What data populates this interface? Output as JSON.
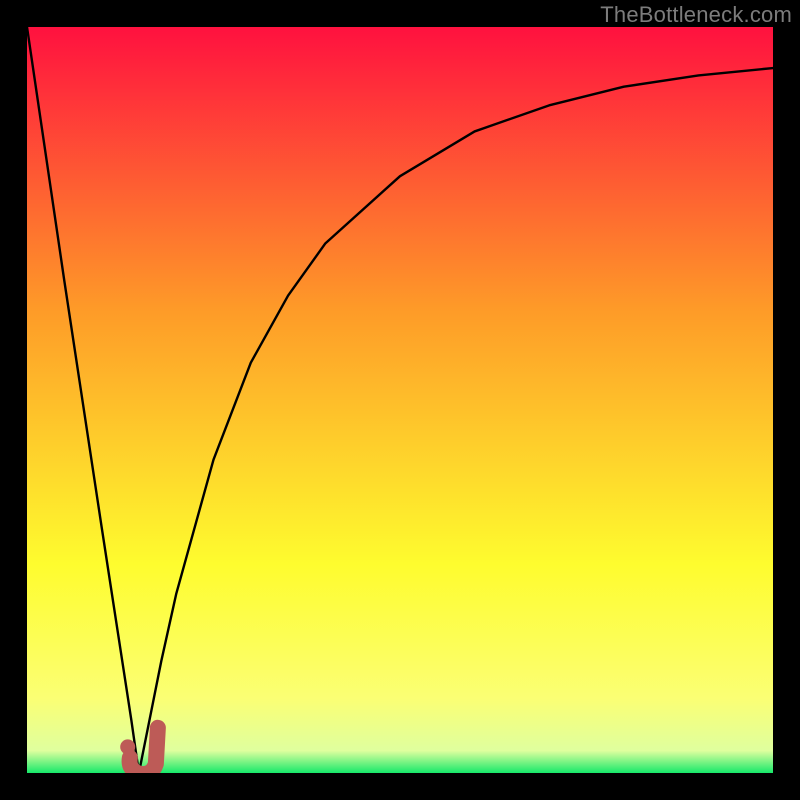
{
  "watermark": "TheBottleneck.com",
  "colors": {
    "frame": "#000000",
    "curve": "#000000",
    "marker_fill": "#bd5b57",
    "marker_stroke": "#bd5b57",
    "grad_top": "#ff113f",
    "grad_mid1": "#fe9b28",
    "grad_mid2": "#fefc2e",
    "grad_band": "#fbff74",
    "grad_bot": "#17e96a"
  },
  "chart_data": {
    "type": "line",
    "title": "",
    "xlabel": "",
    "ylabel": "",
    "xlim": [
      0,
      10
    ],
    "ylim": [
      0,
      100
    ],
    "grid": false,
    "series": [
      {
        "name": "bottleneck-curve",
        "x": [
          0.0,
          0.5,
          1.0,
          1.2,
          1.4,
          1.5,
          1.6,
          1.8,
          2.0,
          2.5,
          3.0,
          3.5,
          4.0,
          5.0,
          6.0,
          7.0,
          8.0,
          9.0,
          10.0
        ],
        "values": [
          100,
          66,
          33,
          20,
          7,
          0,
          5,
          15,
          24,
          42,
          55,
          64,
          71,
          80,
          86,
          89.5,
          92,
          93.5,
          94.5
        ]
      }
    ],
    "markers": [
      {
        "name": "marker-dot",
        "shape": "dot",
        "x": 1.35,
        "y": 3.5
      },
      {
        "name": "marker-hook",
        "shape": "hook",
        "x": 1.62,
        "y": 1.5
      }
    ],
    "gradient_bands": [
      {
        "label": "red",
        "from_y": 100,
        "to_y": 70
      },
      {
        "label": "orange",
        "from_y": 70,
        "to_y": 40
      },
      {
        "label": "yellow",
        "from_y": 40,
        "to_y": 10
      },
      {
        "label": "pale",
        "from_y": 10,
        "to_y": 3
      },
      {
        "label": "green",
        "from_y": 3,
        "to_y": 0
      }
    ]
  }
}
